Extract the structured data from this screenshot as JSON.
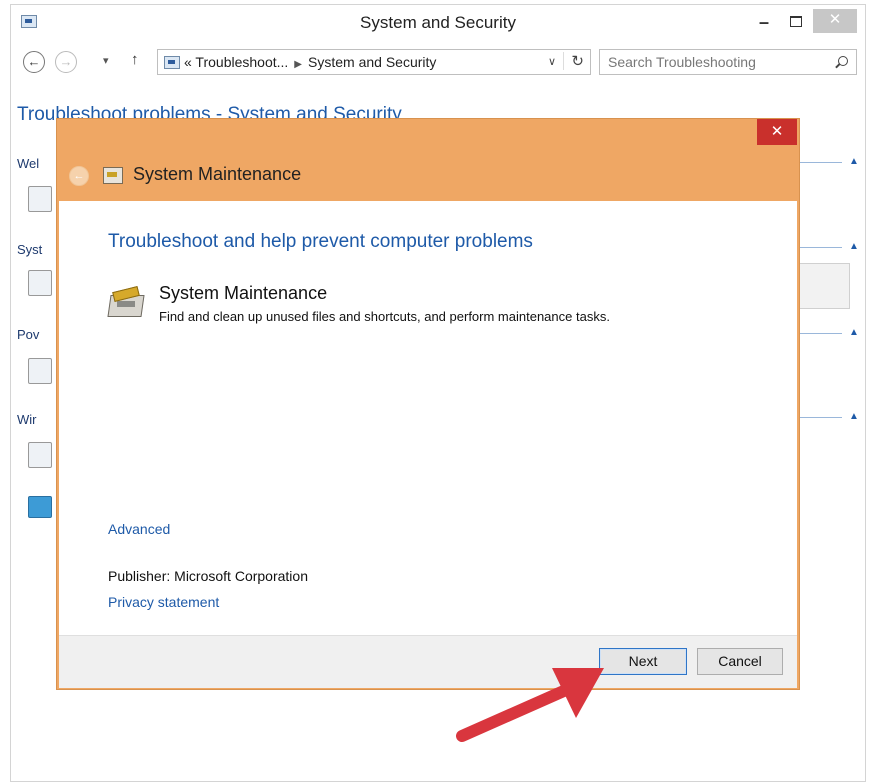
{
  "window": {
    "title": "System and Security",
    "controls": {
      "minimize": "–",
      "close": "✕"
    }
  },
  "nav": {
    "back": "←",
    "forward": "→",
    "recent": "▾",
    "up": "↑",
    "breadcrumb": [
      "« Troubleshoot...",
      "System and Security"
    ],
    "dropdown": "∨",
    "refresh": "↻",
    "search_placeholder": "Search Troubleshooting"
  },
  "background": {
    "heading": "Troubleshoot problems - System and Security",
    "sections": [
      "Wel",
      "Syst",
      "Pov",
      "Wir"
    ]
  },
  "dialog": {
    "close": "✕",
    "back": "←",
    "title": "System Maintenance",
    "heading": "Troubleshoot and help prevent computer problems",
    "task": {
      "title": "System Maintenance",
      "description": "Find and clean up unused files and shortcuts, and perform maintenance tasks."
    },
    "advanced_link": "Advanced",
    "publisher_label": "Publisher:",
    "publisher_name": "Microsoft Corporation",
    "privacy_link": "Privacy statement",
    "buttons": {
      "next": "Next",
      "cancel": "Cancel"
    }
  },
  "colors": {
    "dialog_frame": "#efa764",
    "dialog_close": "#c9302c",
    "link": "#1e5aa8",
    "annotation_arrow": "#d9363e"
  }
}
